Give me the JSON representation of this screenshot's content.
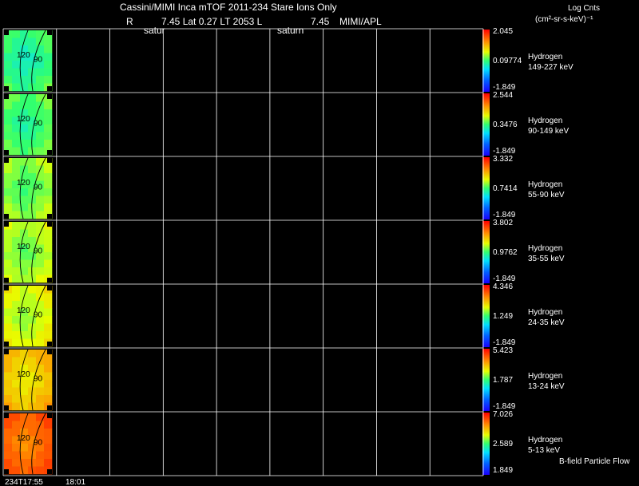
{
  "header": {
    "title": "Cassini/MIMI Inca mTOF  2011-234   Stare   Ions Only",
    "ephem_r_label": "R",
    "ephem_values": "7.45 Lat 0.27 LT 2053 L",
    "ephem_l_value": "7.45",
    "ephem_source": "MIMI/APL",
    "sub_label_1": "satur",
    "sub_label_2": "saturn"
  },
  "units": {
    "title": "Log Cnts",
    "units_text": "(cm²-sr-s-keV)⁻¹"
  },
  "footer": {
    "time_start": "234T17:55",
    "time_next": "18:01",
    "bfield_label": "B-field Particle Flow"
  },
  "colors": {
    "background": "#000000",
    "grid": "#ffffff",
    "text": "#ffffff",
    "contour": "#000000"
  },
  "chart_data": {
    "type": "heatmap",
    "title": "Cassini/MIMI Inca mTOF  2011-234   Stare   Ions Only",
    "panel_columns": 9,
    "image_columns_filled": 1,
    "image_contour_labels": [
      "120",
      "90"
    ],
    "x_tick_labels": [
      "234T17:55",
      "18:01"
    ],
    "colorbar_scale": "log",
    "panels": [
      {
        "species": "Hydrogen",
        "energy": "149-227 keV",
        "cbar_max": "2.045",
        "cbar_mid": "0.09774",
        "cbar_min": "-1.849",
        "level": 0.44
      },
      {
        "species": "Hydrogen",
        "energy": "90-149 keV",
        "cbar_max": "2.544",
        "cbar_mid": "0.3476",
        "cbar_min": "-1.849",
        "level": 0.47
      },
      {
        "species": "Hydrogen",
        "energy": "55-90 keV",
        "cbar_max": "3.332",
        "cbar_mid": "0.7414",
        "cbar_min": "-1.849",
        "level": 0.52
      },
      {
        "species": "Hydrogen",
        "energy": "35-55 keV",
        "cbar_max": "3.802",
        "cbar_mid": "0.9762",
        "cbar_min": "-1.849",
        "level": 0.55
      },
      {
        "species": "Hydrogen",
        "energy": "24-35 keV",
        "cbar_max": "4.346",
        "cbar_mid": "1.249",
        "cbar_min": "-1.849",
        "level": 0.59
      },
      {
        "species": "Hydrogen",
        "energy": "13-24 keV",
        "cbar_max": "5.423",
        "cbar_mid": "1.787",
        "cbar_min": "-1.849",
        "level": 0.68
      },
      {
        "species": "Hydrogen",
        "energy": "5-13 keV",
        "cbar_max": "7.026",
        "cbar_mid": "2.589",
        "cbar_min": "1.849",
        "level": 0.82
      }
    ]
  }
}
